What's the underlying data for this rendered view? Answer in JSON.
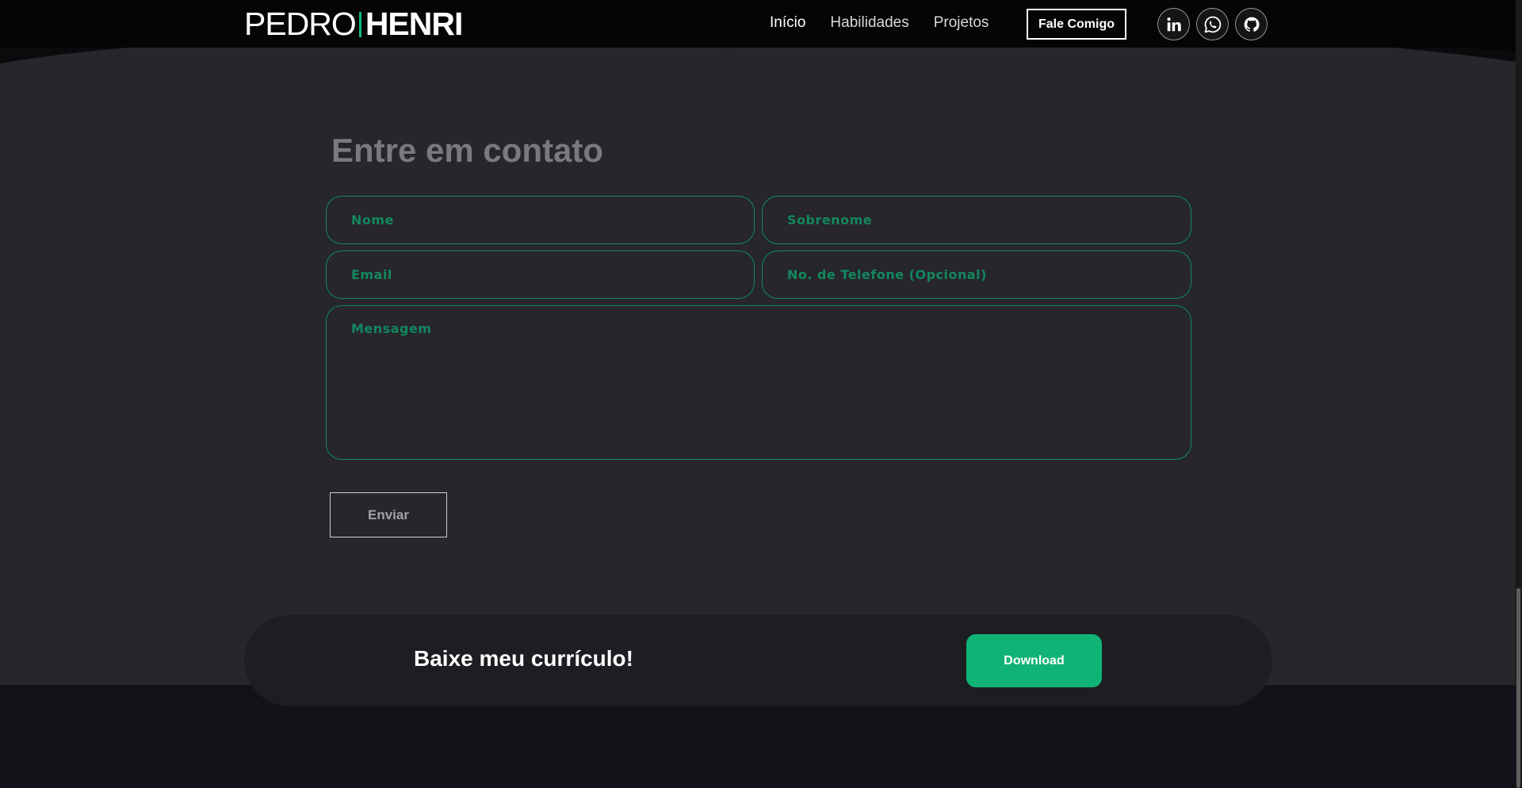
{
  "header": {
    "logo_first": "PEDRO",
    "logo_last": "HENRI",
    "nav": [
      {
        "label": "Início",
        "active": true
      },
      {
        "label": "Habilidades",
        "active": false
      },
      {
        "label": "Projetos",
        "active": false
      }
    ],
    "cta_label": "Fale Comigo",
    "socials": [
      "linkedin-icon",
      "whatsapp-icon",
      "github-icon"
    ]
  },
  "contact": {
    "title": "Entre em contato",
    "fields": {
      "first_name": {
        "placeholder": "Nome",
        "value": ""
      },
      "last_name": {
        "placeholder": "Sobrenome",
        "value": ""
      },
      "email": {
        "placeholder": "Email",
        "value": ""
      },
      "phone": {
        "placeholder": "No. de Telefone (Opcional)",
        "value": ""
      },
      "message": {
        "placeholder": "Mensagem",
        "value": ""
      }
    },
    "submit_label": "Enviar"
  },
  "resume_banner": {
    "title": "Baixe meu currículo!",
    "button_label": "Download"
  },
  "colors": {
    "accent": "#10b981",
    "section_bg": "#26262b",
    "navbar_bg": "#050505",
    "footer_bg": "#121219"
  }
}
